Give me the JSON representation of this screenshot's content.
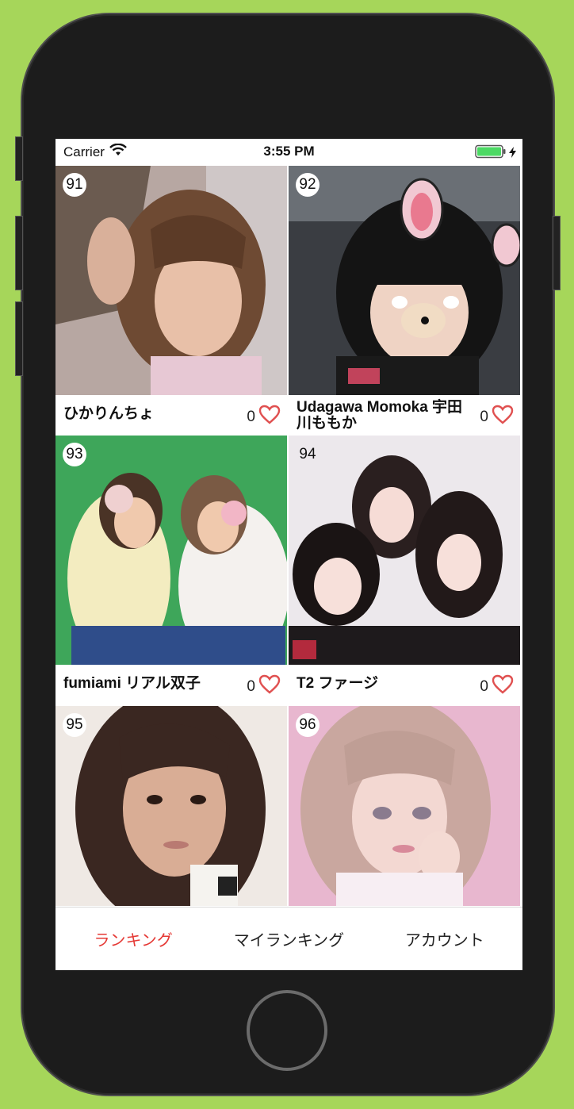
{
  "status_bar": {
    "carrier": "Carrier",
    "time": "3:55 PM"
  },
  "items": [
    {
      "rank": "91",
      "name": "ひかりんちょ",
      "likes": "0"
    },
    {
      "rank": "92",
      "name": "Udagawa Momoka 宇田川ももか",
      "likes": "0"
    },
    {
      "rank": "93",
      "name": "fumiami リアル双子",
      "likes": "0"
    },
    {
      "rank": "94",
      "name": "T2 ファージ",
      "likes": "0"
    },
    {
      "rank": "95"
    },
    {
      "rank": "96"
    }
  ],
  "tabs": [
    {
      "label": "ランキング",
      "active": true
    },
    {
      "label": "マイランキング",
      "active": false
    },
    {
      "label": "アカウント",
      "active": false
    }
  ],
  "colors": {
    "accent": "#e53935",
    "heart": "#e05050",
    "background": "#a6d65a",
    "device": "#1c1c1c",
    "battery": "#4cd964"
  },
  "icons": [
    "wifi-icon",
    "battery-icon",
    "charging-bolt-icon",
    "heart-icon"
  ]
}
